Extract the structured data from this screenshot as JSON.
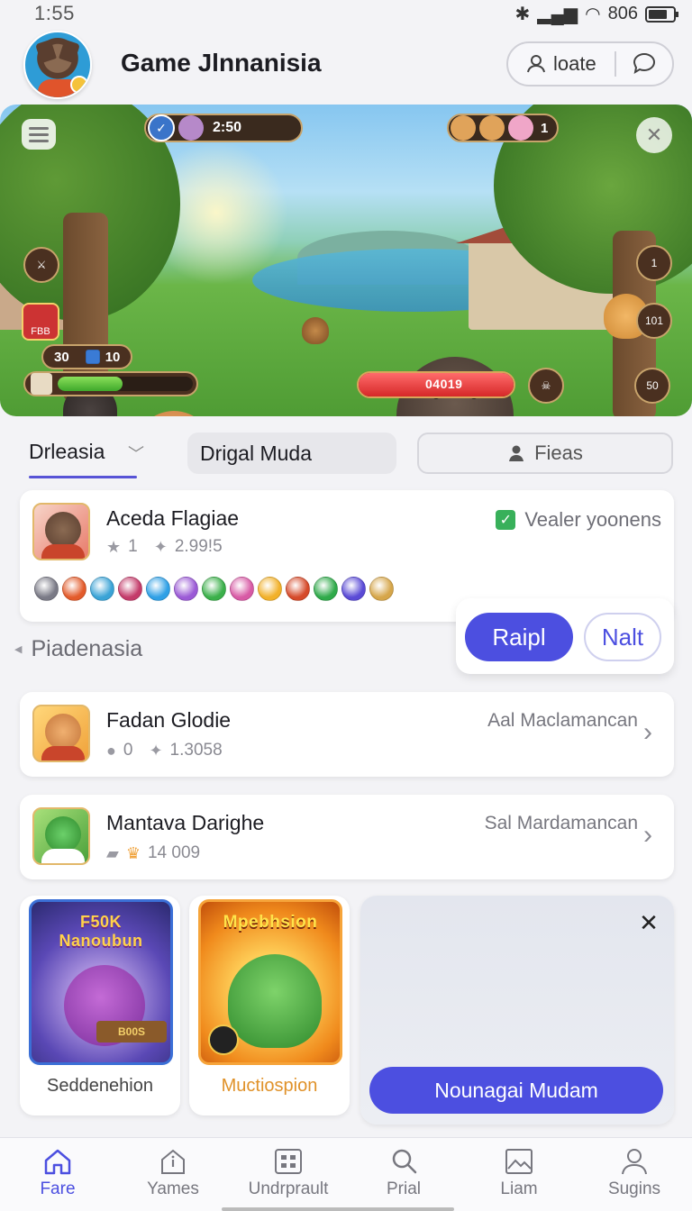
{
  "status_bar": {
    "time": "1:55",
    "signal_text": "806"
  },
  "header": {
    "title": "Game Jlnnanisia",
    "locate_label": "loate"
  },
  "banner": {
    "timer": "2:50",
    "top_right_count": "1",
    "left_badge": "FBB",
    "counter_a": "30",
    "counter_b": "10",
    "player_health_percent": 48,
    "enemy_hp_value": "04019",
    "enemy_health_percent": 100,
    "side_icon_1": "1",
    "side_icon_2": "101",
    "side_icon_3": "50"
  },
  "tabs": {
    "active": "Drleasia",
    "second": "Drigal Muda",
    "filter": "Fieas"
  },
  "featured": {
    "title": "Aceda Flagiae",
    "stat_a": "1",
    "stat_b": "2.99!5",
    "verified_text": "Vealer yoonens",
    "chip_colors": [
      "#7a7a86",
      "#e35b2b",
      "#3aa3d6",
      "#c43b6a",
      "#2fa0e6",
      "#9b5ad6",
      "#3bb04a",
      "#d85aa5",
      "#f2b12a",
      "#d64a2a",
      "#2faa4a",
      "#5a4ad6",
      "#d6a64a"
    ],
    "section_label": "Piadenasia",
    "primary_button": "Raipl",
    "secondary_button": "Nalt"
  },
  "list": [
    {
      "title": "Fadan Glodie",
      "stat_a": "0",
      "stat_b": "1.3058",
      "side": "Aal Maclamancan"
    },
    {
      "title": "Mantava Darighe",
      "stat_a": "",
      "stat_b": "14 009",
      "side": "Sal Mardamancan"
    }
  ],
  "tiles": [
    {
      "art_title_top": "F50K",
      "art_title": "Nanoubun",
      "art_sign": "B00S",
      "label": "Seddenehion"
    },
    {
      "art_title": "Mpebhsion",
      "label": "Muctiospion"
    }
  ],
  "promo": {
    "cta": "Nounagai Mudam"
  },
  "nav": [
    {
      "label": "Fare",
      "icon": "home-icon"
    },
    {
      "label": "Yames",
      "icon": "info-icon"
    },
    {
      "label": "Undrprault",
      "icon": "grid-icon"
    },
    {
      "label": "Prial",
      "icon": "search-icon"
    },
    {
      "label": "Liam",
      "icon": "image-icon"
    },
    {
      "label": "Sugins",
      "icon": "user-icon"
    }
  ],
  "colors": {
    "accent": "#4c4fe0",
    "verified": "#38b05a",
    "hp_green": "#3ea82b",
    "hp_red": "#d62828"
  }
}
